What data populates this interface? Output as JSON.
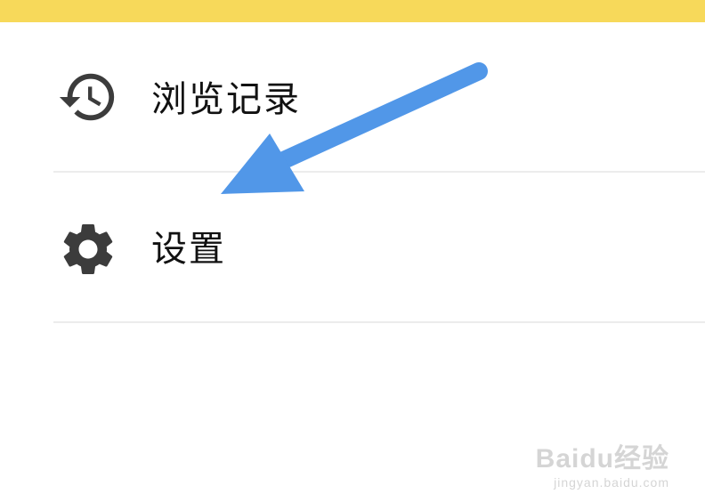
{
  "colors": {
    "top_bar": "#f7d95a",
    "icon": "#3c3c3c",
    "arrow": "#5197e8",
    "divider": "#ececec"
  },
  "menu": {
    "items": [
      {
        "label": "浏览记录",
        "icon": "history-icon"
      },
      {
        "label": "设置",
        "icon": "gear-icon"
      }
    ]
  },
  "watermark": {
    "brand": "Baidu经验",
    "url": "jingyan.baidu.com"
  }
}
